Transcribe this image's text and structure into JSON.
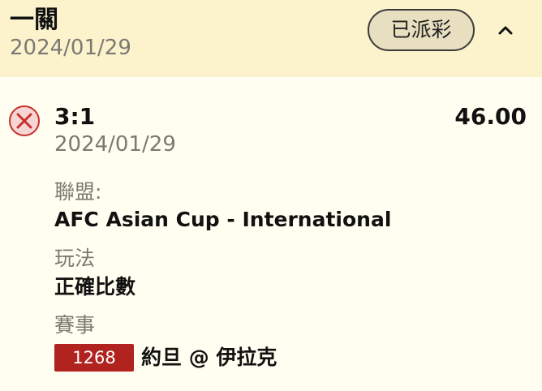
{
  "header": {
    "title": "一關",
    "date": "2024/01/29",
    "status": "已派彩"
  },
  "bet": {
    "result_icon": "cross-circle-icon",
    "result_color": "#c7302c",
    "score": "3:1",
    "odds": "46.00",
    "date": "2024/01/29"
  },
  "details": {
    "league_label": "聯盟:",
    "league_value": "AFC Asian Cup - International",
    "bet_type_label": "玩法",
    "bet_type_value": "正確比數",
    "match_label": "賽事",
    "match_code": "1268",
    "match_name": "約旦 @ 伊拉克"
  },
  "colors": {
    "header_bg": "#fcf3cd",
    "body_bg": "#fffef0",
    "badge_bg": "#e8dfc0",
    "match_code_bg": "#b0231e"
  }
}
